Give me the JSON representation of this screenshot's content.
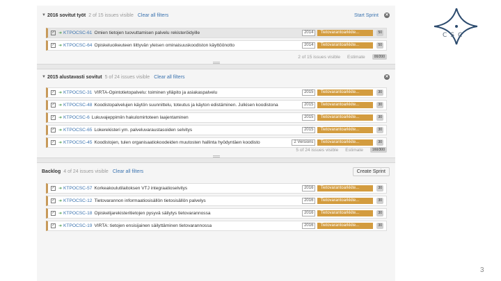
{
  "sprints": [
    {
      "title": "2016 sovitut työt",
      "count": "2 of 15 issues visible",
      "clear": "Clear all filters",
      "action": "Start Sprint",
      "footer_count": "2 of 15 issues visible",
      "footer_estimate": "Estimate",
      "footer_badge": "00/200",
      "issues": [
        {
          "key": "KTPOCSC-61",
          "summary": "Omien tietojen tuovuttamisen palvelu rekisteröidyille",
          "version": "2014",
          "epic": "Tietovarantoarkkite...",
          "estimate": "50",
          "selected": true
        },
        {
          "key": "KTPOCSC-64",
          "summary": "Opiskeluoikeuteen liittyvän yleisen ominaisuuskoodiston käyttöönotto",
          "version": "2014",
          "epic": "Tietovarantoarkkite...",
          "estimate": "50",
          "selected": false
        }
      ]
    },
    {
      "title": "2015 alustavasti sovitut",
      "count": "5 of 24 issues visible",
      "clear": "Clear all filters",
      "footer_count": "5 of 24 issues visible",
      "footer_estimate": "Estimate",
      "footer_badge": "160/300",
      "issues": [
        {
          "key": "KTPOCSC-31",
          "summary": "VIRTA-Opintotietopalvelu: toiminen ylläpito ja asiakaspalvelu",
          "version": "2015",
          "epic": "Tietovarantoarkkite...",
          "estimate": "30",
          "selected": false
        },
        {
          "key": "KTPOCSC-48",
          "summary": "Koodistopalvelujen käytön suunnittelu, toteutus ja käyton edistäminen. Julkisen koodistona",
          "version": "2015",
          "epic": "Tietovarantoarkkite...",
          "estimate": "30",
          "selected": false
        },
        {
          "key": "KTPOCSC-6",
          "summary": "Lukuvajeppimiin hakulomirtoteen laajentaminen",
          "version": "2015",
          "epic": "Tietovarantoarkkite...",
          "estimate": "30",
          "selected": false
        },
        {
          "key": "KTPOCSC-65",
          "summary": "Lokerekisteri ym. palveluvaraustasoiden selvitys",
          "version": "2015",
          "epic": "Tietovarantoarkkite...",
          "estimate": "30",
          "selected": false
        },
        {
          "key": "KTPOCSC-45",
          "summary": "Koodistojen, tulen organisaatiokoodeiden muutosten hallinta hyödyntäen koodisto",
          "version": "2 Versions",
          "epic": "Tietovarantoarkkite...",
          "estimate": "30",
          "selected": false
        }
      ]
    },
    {
      "title": "Backlog",
      "count": "4 of 24 issues visible",
      "clear": "Clear all filters",
      "action": "Create Sprint",
      "issues": [
        {
          "key": "KTPOCSC-57",
          "summary": "Korkeakoulutilaitoksen VTJ integraatioselvitys",
          "version": "2016",
          "epic": "Tietovarantoarkkite...",
          "estimate": "30",
          "selected": false
        },
        {
          "key": "KTPOCSC-12",
          "summary": "Tietovarannon informaatiosisällön tietosisällön palvelys",
          "version": "2016",
          "epic": "Tietovarantoarkkite...",
          "estimate": "30",
          "selected": false
        },
        {
          "key": "KTPOCSC-18",
          "summary": "Opiskelijarekisteritietojen pysyvä säilytys tietovarannossa",
          "version": "2016",
          "epic": "Tietovarantoarkkite...",
          "estimate": "30",
          "selected": false
        },
        {
          "key": "KTPOCSC-19",
          "summary": "VIRTA: tietojen ensisijainen säilyttäminen tietovarannossa",
          "version": "2016",
          "epic": "Tietovarantoarkkite...",
          "estimate": "30",
          "selected": false
        }
      ]
    }
  ],
  "logo_text": "CSC",
  "page_number": "3",
  "colors": {
    "accent": "#d39c3f",
    "link": "#3b73af",
    "rank_bar": "#c79a5a"
  }
}
